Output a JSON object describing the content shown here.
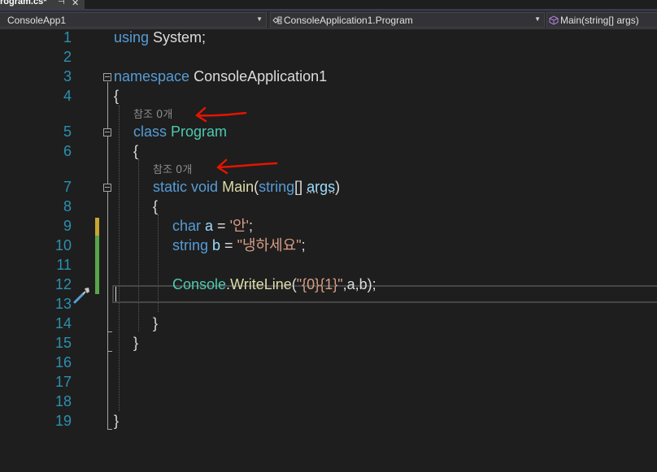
{
  "tab": {
    "title": "rogram.cs*",
    "pin_glyph": "⊣",
    "close_glyph": "✕"
  },
  "navbar": {
    "project": "ConsoleApp1",
    "type": "ConsoleApplication1.Program",
    "member": "Main(string[] args)",
    "dropdown_glyph": "▼"
  },
  "code": {
    "line_numbers": [
      "1",
      "2",
      "3",
      "4",
      "5",
      "6",
      "7",
      "8",
      "9",
      "10",
      "11",
      "12",
      "13",
      "14",
      "15",
      "16",
      "17",
      "18",
      "19"
    ],
    "l1_kw": "using",
    "l1_rest": " System;",
    "l3_kw": "namespace",
    "l3_rest": " ConsoleApplication1",
    "open_brace": "{",
    "close_brace": "}",
    "codelens_program": "참조 0개",
    "l5_kw": "class",
    "l5_type": "Program",
    "codelens_main": "참조 0개",
    "l7_kw1": "static",
    "l7_kw2": "void",
    "l7_fn": "Main",
    "l7_paren_open": "(",
    "l7_kw3": "string",
    "l7_brackets": "[] ",
    "l7_param": "args",
    "l7_paren_close": ")",
    "l9_kw": "char",
    "l9_var": "a",
    "l9_op": " = ",
    "l9_val": "'안'",
    "l9_end": ";",
    "l10_kw": "string",
    "l10_var": "b",
    "l10_op": " = ",
    "l10_val": "\"냉하세요\"",
    "l10_end": ";",
    "l12_type": "Console",
    "l12_dot": ".",
    "l12_fn": "WriteLine",
    "l12_open": "(",
    "l12_str": "\"{0}{1}\"",
    "l12_args": ",a,b);"
  },
  "colors": {
    "background": "#1e1e1e",
    "keyword": "#569cd6",
    "type": "#4ec9b0",
    "method": "#dcdcaa",
    "parameter": "#9cdcfe",
    "string": "#d69d85",
    "line_number": "#2b91af",
    "change_saved": "#57a64a",
    "change_unsaved": "#c8a533",
    "annotation_arrow": "#e51400"
  },
  "icons": {
    "quick_actions": "screwdriver-icon",
    "project": "csharp-project-icon",
    "type": "class-icon",
    "member": "method-icon"
  }
}
